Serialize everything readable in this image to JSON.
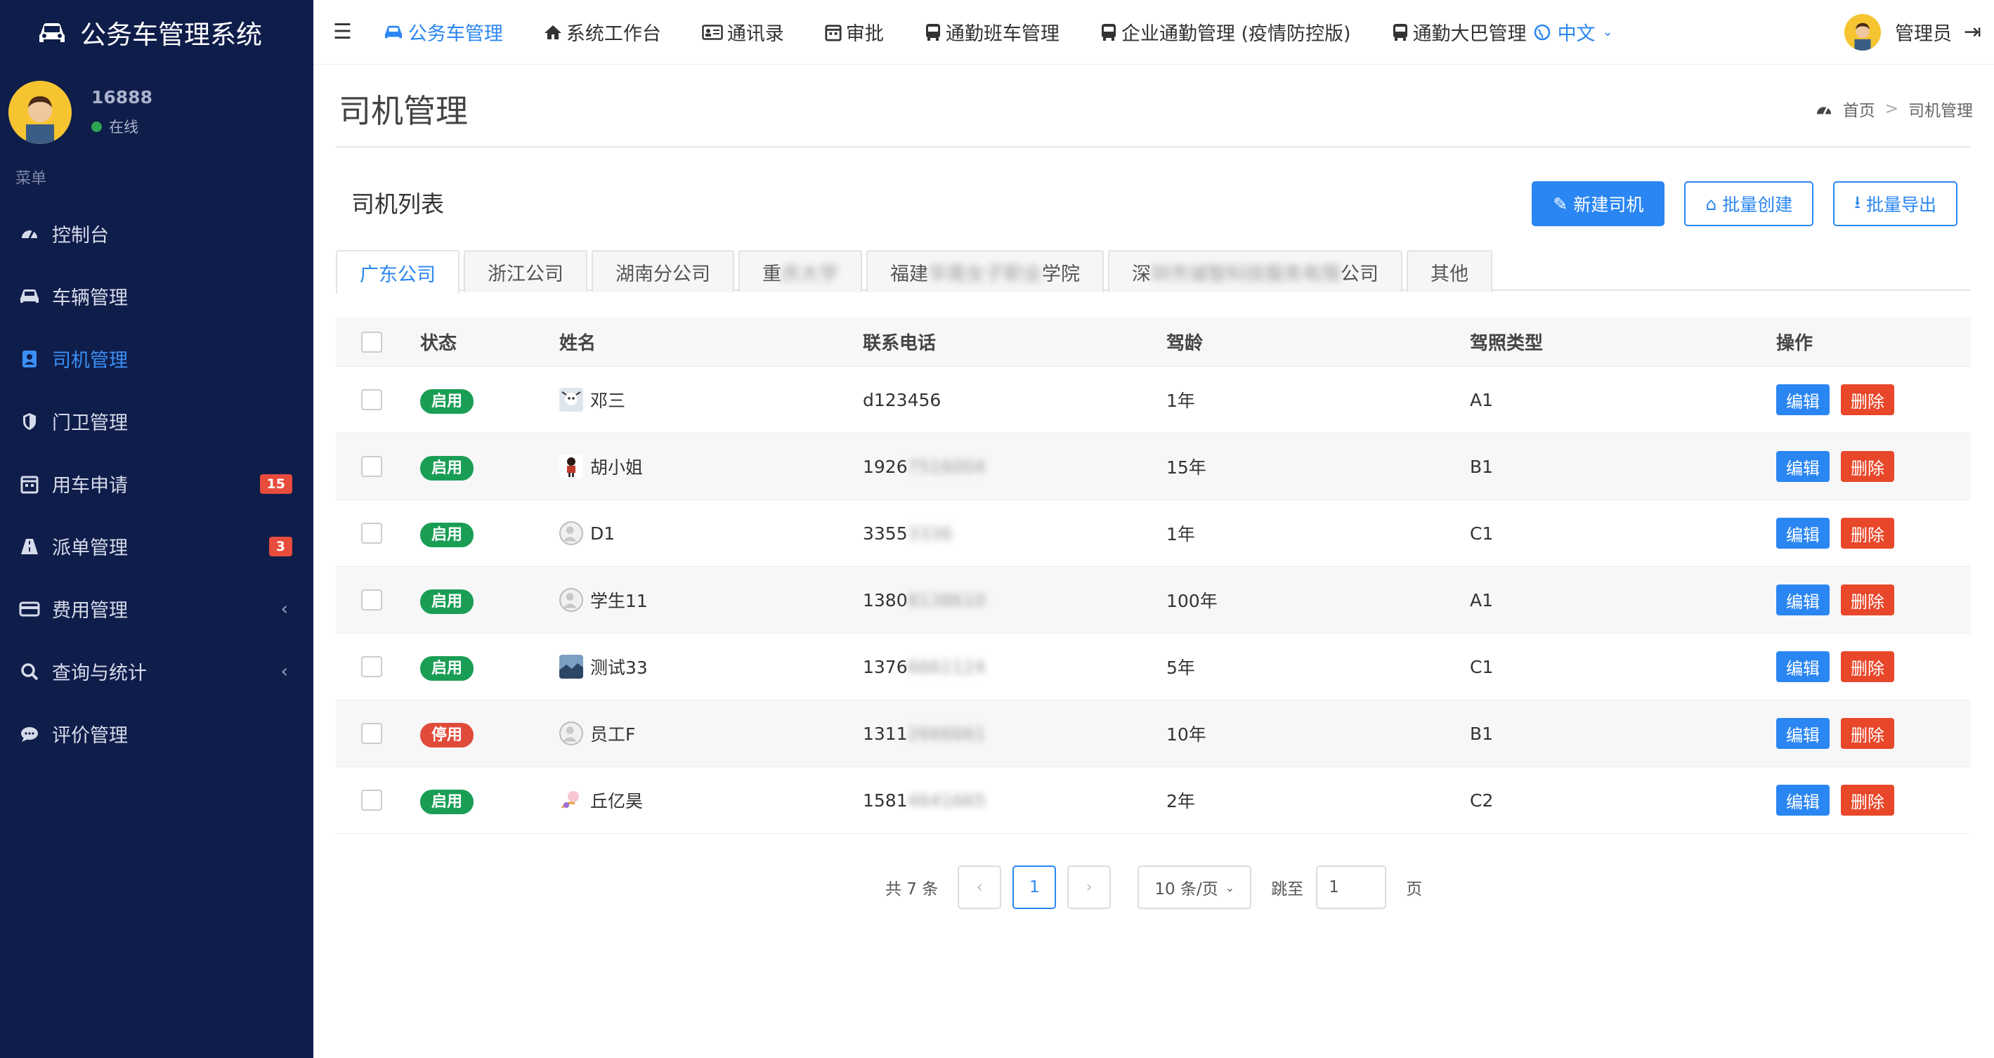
{
  "app": {
    "title": "公务车管理系统"
  },
  "user": {
    "name": "16888",
    "status": "在线"
  },
  "sidebar": {
    "section": "菜单",
    "items": [
      {
        "label": "控制台"
      },
      {
        "label": "车辆管理"
      },
      {
        "label": "司机管理"
      },
      {
        "label": "门卫管理"
      },
      {
        "label": "用车申请",
        "badge": "15"
      },
      {
        "label": "派单管理",
        "badge": "3"
      },
      {
        "label": "费用管理"
      },
      {
        "label": "查询与统计"
      },
      {
        "label": "评价管理"
      }
    ]
  },
  "topnav": {
    "items": [
      {
        "label": "公务车管理"
      },
      {
        "label": "系统工作台"
      },
      {
        "label": "通讯录"
      },
      {
        "label": "审批"
      },
      {
        "label": "通勤班车管理"
      },
      {
        "label": "企业通勤管理 (疫情防控版)"
      },
      {
        "label": "通勤大巴管理"
      }
    ],
    "lang": "中文",
    "admin": "管理员"
  },
  "page": {
    "title": "司机管理",
    "breadcrumb": {
      "home": "首页",
      "current": "司机管理"
    },
    "panel_title": "司机列表",
    "buttons": {
      "new": "新建司机",
      "batch_create": "批量创建",
      "batch_export": "批量导出"
    }
  },
  "tabs": [
    {
      "label": "广东公司"
    },
    {
      "label": "浙江公司"
    },
    {
      "label": "湖南分公司"
    },
    {
      "pre": "重",
      "blur": "庆大学",
      "post": ""
    },
    {
      "pre": "福建",
      "blur": "华南女子职业",
      "post": "学院"
    },
    {
      "pre": "深",
      "blur": "圳市诚智科技服务有限",
      "post": "公司"
    },
    {
      "label": "其他"
    }
  ],
  "table": {
    "headers": {
      "status": "状态",
      "name": "姓名",
      "phone": "联系电话",
      "age": "驾龄",
      "license": "驾照类型",
      "ops": "操作"
    },
    "rows": [
      {
        "status": "启用",
        "name": "邓三",
        "phone": "d123456",
        "phone_blur": "",
        "age": "1年",
        "license": "A1"
      },
      {
        "status": "启用",
        "name": "胡小姐",
        "phone": "1926",
        "phone_blur": "7516004",
        "age": "15年",
        "license": "B1"
      },
      {
        "status": "启用",
        "name": "D1",
        "phone": "3355",
        "phone_blur": "3336",
        "age": "1年",
        "license": "C1"
      },
      {
        "status": "启用",
        "name": "学生11",
        "phone": "1380",
        "phone_blur": "8138610",
        "age": "100年",
        "license": "A1"
      },
      {
        "status": "启用",
        "name": "测试33",
        "phone": "1376",
        "phone_blur": "6661124",
        "age": "5年",
        "license": "C1"
      },
      {
        "status": "停用",
        "name": "员工F",
        "phone": "1311",
        "phone_blur": "2666661",
        "age": "10年",
        "license": "B1"
      },
      {
        "status": "启用",
        "name": "丘亿昊",
        "phone": "1581",
        "phone_blur": "4641665",
        "age": "2年",
        "license": "C2"
      }
    ],
    "edit_label": "编辑",
    "delete_label": "删除"
  },
  "pagination": {
    "total": "共 7 条",
    "current": "1",
    "size": "10 条/页",
    "jump": "跳至",
    "jump_value": "1",
    "page_unit": "页"
  },
  "colors": {
    "sidebar": "#0f1d4a",
    "primary": "#2a86f2",
    "enabled": "#1a9e55",
    "disabled": "#e04b3a",
    "danger": "#e8472a"
  }
}
